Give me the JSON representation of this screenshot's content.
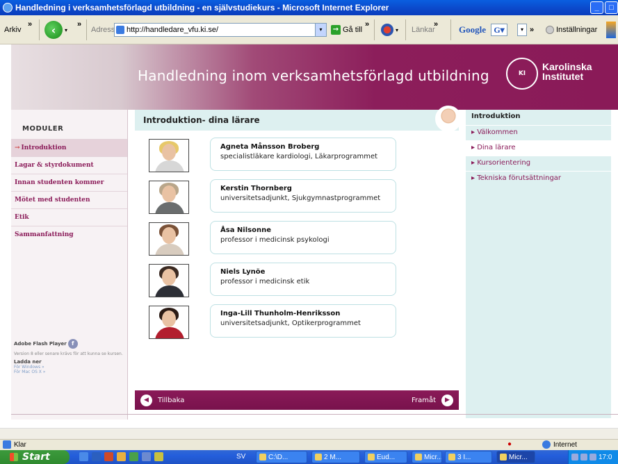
{
  "window": {
    "title": "Handledning i verksamhetsförlagd utbildning - en självstudiekurs - Microsoft Internet Explorer"
  },
  "toolbar": {
    "archive": "Arkiv",
    "chevron": "»",
    "address_label": "Adress",
    "url": "http://handledare_vfu.ki.se/",
    "go": "Gå till",
    "links": "Länkar",
    "google": "Google",
    "settings": "Inställningar"
  },
  "banner": {
    "title": "Handledning inom verksamhetsförlagd utbildning",
    "logo_line1": "Karolinska",
    "logo_line2": "Institutet"
  },
  "leftnav": {
    "heading": "MODULER",
    "items": [
      {
        "label": "Introduktion",
        "active": true
      },
      {
        "label": "Lagar & styrdokument"
      },
      {
        "label": "Innan studenten kommer"
      },
      {
        "label": "Mötet med studenten"
      },
      {
        "label": "Etik"
      },
      {
        "label": "Sammanfattning"
      }
    ],
    "flash": {
      "title": "Adobe Flash Player",
      "note": "Version 8 eller senare krävs för att kunna se kursen.",
      "download": "Ladda ner",
      "windows": "För Windows »",
      "mac": "För Mac OS X »"
    }
  },
  "main": {
    "heading": "Introduktion- dina lärare",
    "people": [
      {
        "name": "Agneta Månsson Broberg",
        "role": "specialistläkare kardiologi, Läkarprogrammet"
      },
      {
        "name": "Kerstin Thornberg",
        "role": "universitetsadjunkt, Sjukgymnastprogrammet"
      },
      {
        "name": "Åsa Nilsonne",
        "role": "professor i medicinsk psykologi"
      },
      {
        "name": "Niels Lynöe",
        "role": "professor i medicinsk etik"
      },
      {
        "name": "Inga-Lill Thunholm-Henriksson",
        "role": "universitetsadjunkt, Optikerprogrammet"
      }
    ],
    "back": "Tillbaka",
    "forward": "Framåt"
  },
  "rightnav": {
    "title": "Introduktion",
    "items": [
      {
        "label": "Välkommen"
      },
      {
        "label": "Dina lärare",
        "active": true
      },
      {
        "label": "Kursorientering"
      },
      {
        "label": "Tekniska förutsättningar"
      }
    ]
  },
  "statusbar": {
    "status": "Klar",
    "zone": "Internet"
  },
  "taskbar": {
    "start": "Start",
    "lang": "SV",
    "tasks": [
      "C:\\D...",
      "2 M...",
      "Eud...",
      "Micr...",
      "3 I...",
      "Micr..."
    ],
    "clock": "17:0"
  },
  "colors": {
    "plum": "#8a1a58",
    "aqua": "#ddf0f0",
    "xp_blue": "#245edb"
  }
}
